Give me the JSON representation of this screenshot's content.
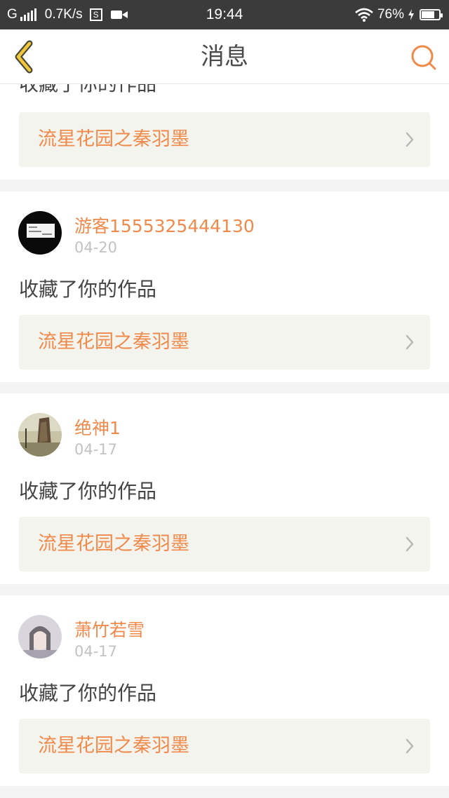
{
  "status_bar": {
    "network": "G",
    "speed": "0.7K/s",
    "s_icon": "S",
    "time": "19:44",
    "battery": "76%"
  },
  "header": {
    "title": "消息",
    "back_icon": "chevron-left-icon",
    "search_icon": "search-icon"
  },
  "colors": {
    "accent": "#f08a4b",
    "back_icon": "#e8b830",
    "date": "#c2c2c2",
    "link_bg": "#f4f4ef"
  },
  "messages": [
    {
      "action": "收藏了你的作品",
      "work_title": "流星花园之秦羽墨"
    },
    {
      "username": "游客1555325444130",
      "date": "04-20",
      "action": "收藏了你的作品",
      "work_title": "流星花园之秦羽墨"
    },
    {
      "username": "绝神1",
      "date": "04-17",
      "action": "收藏了你的作品",
      "work_title": "流星花园之秦羽墨"
    },
    {
      "username": "萧竹若雪",
      "date": "04-17",
      "action": "收藏了你的作品",
      "work_title": "流星花园之秦羽墨"
    }
  ]
}
